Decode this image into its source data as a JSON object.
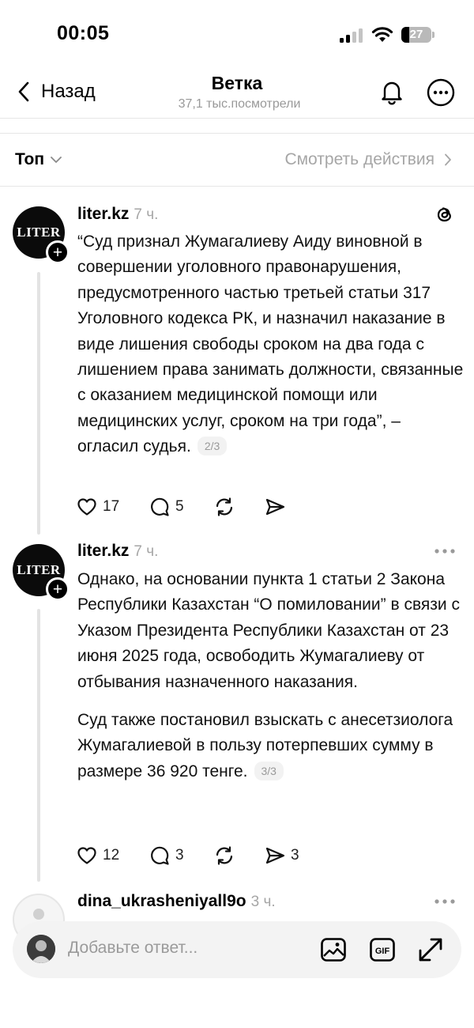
{
  "status_bar": {
    "time": "00:05",
    "battery": "27",
    "battery_level": 0.27
  },
  "header": {
    "back_label": "Назад",
    "title": "Ветка",
    "subtitle": "37,1 тыс.посмотрели"
  },
  "sort": {
    "label": "Топ",
    "activity_label": "Смотреть действия"
  },
  "posts": [
    {
      "author": "liter.kz",
      "time": "7 ч.",
      "avatar_text": "LITER",
      "paragraphs": [
        "“Суд признал Жумагалиеву Аиду виновной в совершении уголовного правонарушения, предусмотренного частью третьей статьи 317 Уголовного кодекса РК, и назначил наказание в виде лишения свободы сроком на два года с лишением права занимать должности, связанные с оказанием медицинской помощи или медицинских услуг, сроком на три года”, – огласил судья."
      ],
      "page_indicator": "2/3",
      "likes": "17",
      "comments": "5",
      "reposts": "",
      "shares": ""
    },
    {
      "author": "liter.kz",
      "time": "7 ч.",
      "avatar_text": "LITER",
      "paragraphs": [
        "Однако, на основании пункта 1 статьи 2 Закона Республики Казахстан “О помиловании” в связи с Указом Президента Республики Казахстан от 23 июня 2025 года, освободить Жумагалиеву от отбывания назначенного наказания.",
        "Суд также постановил взыскать с анесетзиолога Жумагалиевой в пользу потерпевших сумму в размере 36 920 тенге."
      ],
      "page_indicator": "3/3",
      "likes": "12",
      "comments": "3",
      "reposts": "",
      "shares": "3"
    },
    {
      "author": "dina_ukrasheniyall9o",
      "time": "3 ч."
    }
  ],
  "composer": {
    "placeholder": "Добавьте ответ..."
  },
  "icons": {
    "back": "chevron-left-icon",
    "bell": "bell-icon",
    "more": "more-icon",
    "sort": "chevron-down-icon",
    "activity": "chevron-right-icon",
    "threads": "threads-logo-icon",
    "like": "heart-icon",
    "comment": "comment-icon",
    "repost": "repost-icon",
    "share": "send-icon",
    "image": "image-icon",
    "gif": "gif-icon",
    "expand": "expand-icon"
  }
}
